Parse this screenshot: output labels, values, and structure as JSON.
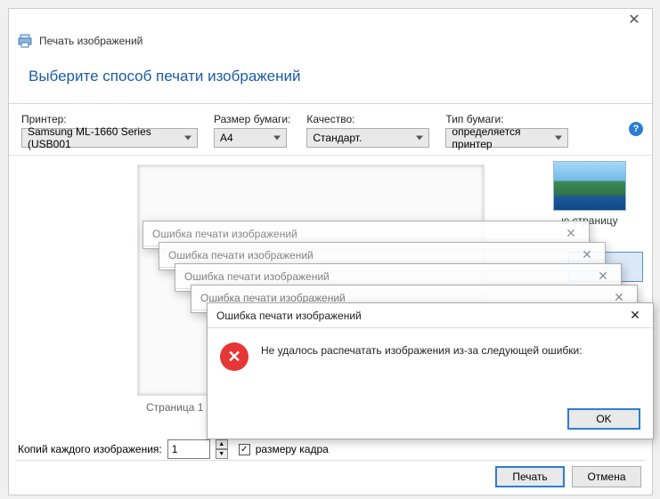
{
  "window": {
    "title": "Печать изображений"
  },
  "instruction": "Выберите способ печати изображений",
  "options": {
    "printer": {
      "label": "Принтер:",
      "value": "Samsung ML-1660 Series (USB001"
    },
    "paper_size": {
      "label": "Размер бумаги:",
      "value": "A4"
    },
    "quality": {
      "label": "Качество:",
      "value": "Стандарт."
    },
    "paper_type": {
      "label": "Тип бумаги:",
      "value": "определяется принтер"
    }
  },
  "preview": {
    "page_indicator": "Страница 1"
  },
  "thumbnail": {
    "label": "ю страницу"
  },
  "copies": {
    "label": "Копий каждого изображения:",
    "value": "1"
  },
  "fit": {
    "label": "размеру кадра"
  },
  "buttons": {
    "print": "Печать",
    "cancel": "Отмена"
  },
  "error": {
    "title": "Ошибка печати изображений",
    "message": "Не удалось распечатать изображения из-за следующей ошибки:",
    "ok": "OK"
  }
}
